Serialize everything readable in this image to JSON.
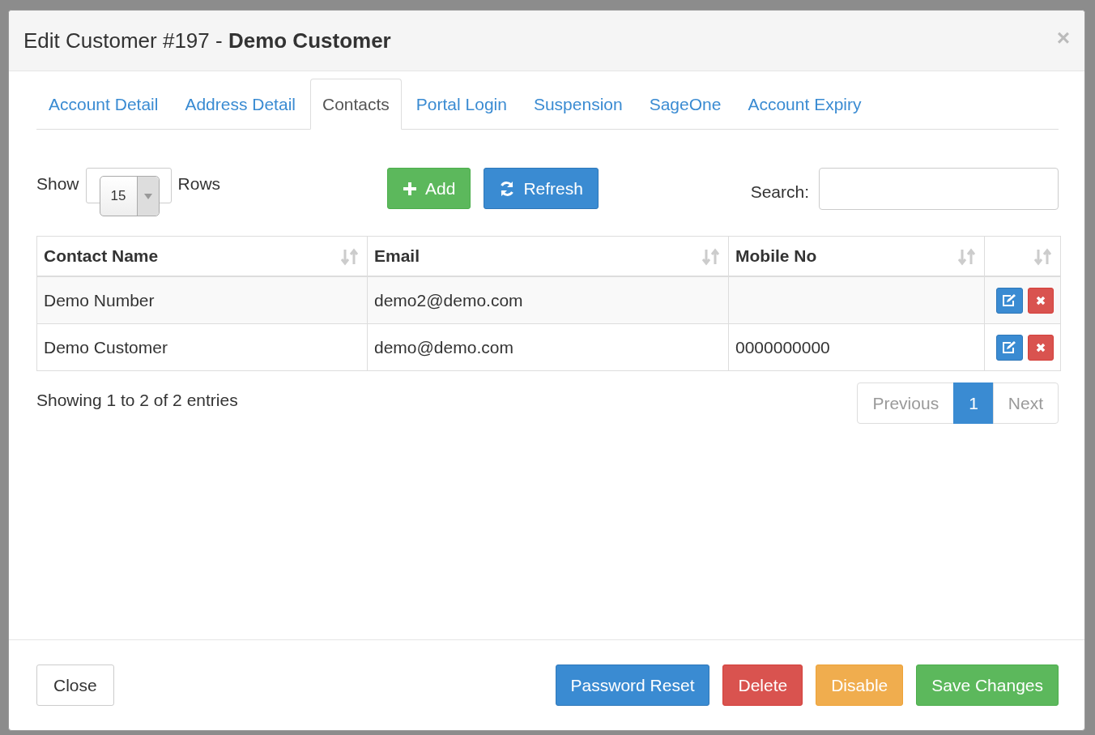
{
  "modal": {
    "title": "Edit Customer #197 - **Demo Customer**",
    "close": "×"
  },
  "tabs": [
    {
      "label": "Account Detail",
      "selected": false
    },
    {
      "label": "Address Detail",
      "selected": false
    },
    {
      "label": "Contacts",
      "selected": true
    },
    {
      "label": "Portal Login",
      "selected": false
    },
    {
      "label": "Suspension",
      "selected": false
    },
    {
      "label": "SageOne",
      "selected": false
    },
    {
      "label": "Account Expiry",
      "selected": false
    }
  ],
  "length": {
    "before": "Show",
    "value": "15",
    "after": "Rows"
  },
  "toolbar": [
    {
      "label": "Add",
      "kind": "success"
    },
    {
      "label": "Refresh",
      "kind": "primary"
    }
  ],
  "search": {
    "label": "Search:"
  },
  "table": {
    "columns": [
      {
        "label": "Contact Name"
      },
      {
        "label": "Email"
      },
      {
        "label": "Mobile No"
      },
      {}
    ],
    "rows": [
      {
        "contact_name": "Demo Number",
        "email": "demo2@demo.com"
      },
      {
        "contact_name": "Demo Customer",
        "email": "demo@demo.com",
        "mobile_no": "0000000000"
      }
    ]
  },
  "info": "Showing 1 to 2 of 2 entries",
  "pagination": [
    {
      "label": "Previous",
      "disabled": true,
      "selected": false
    },
    {
      "label": "1",
      "disabled": false,
      "selected": true
    },
    {
      "label": "Next",
      "disabled": true,
      "selected": false
    }
  ],
  "footer": {
    "close": "Close",
    "buttons": [
      {
        "label": "Password Reset",
        "kind": "primary"
      },
      {
        "label": "Delete",
        "kind": "danger"
      },
      {
        "label": "Disable",
        "kind": "warning"
      },
      {
        "label": "Save Changes",
        "kind": "success"
      }
    ]
  }
}
